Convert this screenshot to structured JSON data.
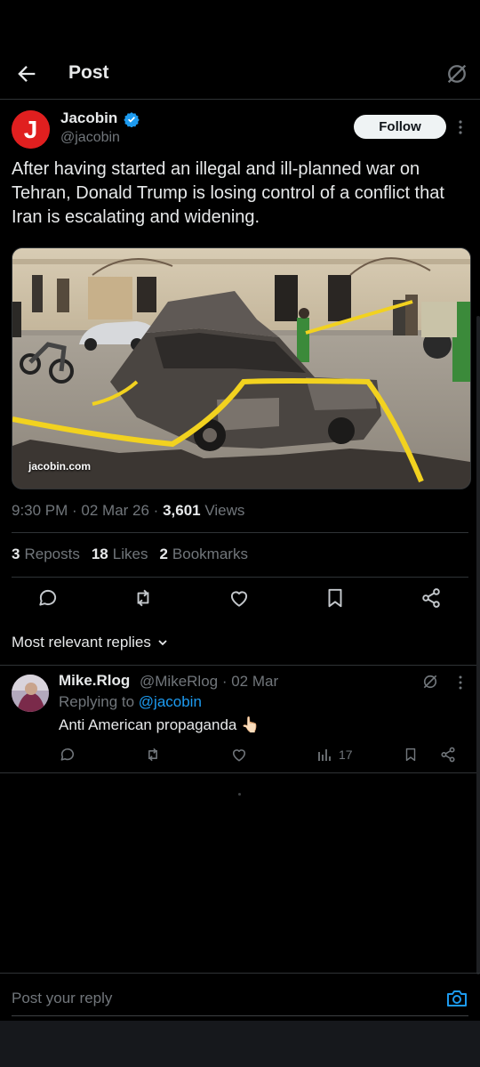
{
  "header": {
    "title": "Post"
  },
  "author": {
    "avatar_letter": "J",
    "name": "Jacobin",
    "handle": "@jacobin",
    "verified_color": "#1d9bf0",
    "follow_label": "Follow"
  },
  "tweet": {
    "text": "After having started an illegal and ill-planned war on Tehran, Donald Trump is losing control of a conflict that Iran is escalating and widening.",
    "media_watermark": "jacobin.com",
    "time": "9:30 PM · 02 Mar 26 · ",
    "views_count": "3,601",
    "views_label": " Views"
  },
  "stats": {
    "reposts_count": "3",
    "reposts_label": "Reposts",
    "likes_count": "18",
    "likes_label": "Likes",
    "bookmarks_count": "2",
    "bookmarks_label": "Bookmarks"
  },
  "sort": {
    "label": "Most relevant replies"
  },
  "reply": {
    "name": "Mike.Rlog",
    "handle_date": "@MikeRlog · 02 Mar",
    "replying_prefix": "Replying to ",
    "replying_handle": "@jacobin",
    "text": "Anti American propaganda 👆🏻",
    "views": "17"
  },
  "composer": {
    "placeholder": "Post your reply"
  },
  "colors": {
    "accent": "#1d9bf0",
    "muted": "#71767b",
    "text": "#e7e9ea",
    "bg": "#000000"
  }
}
